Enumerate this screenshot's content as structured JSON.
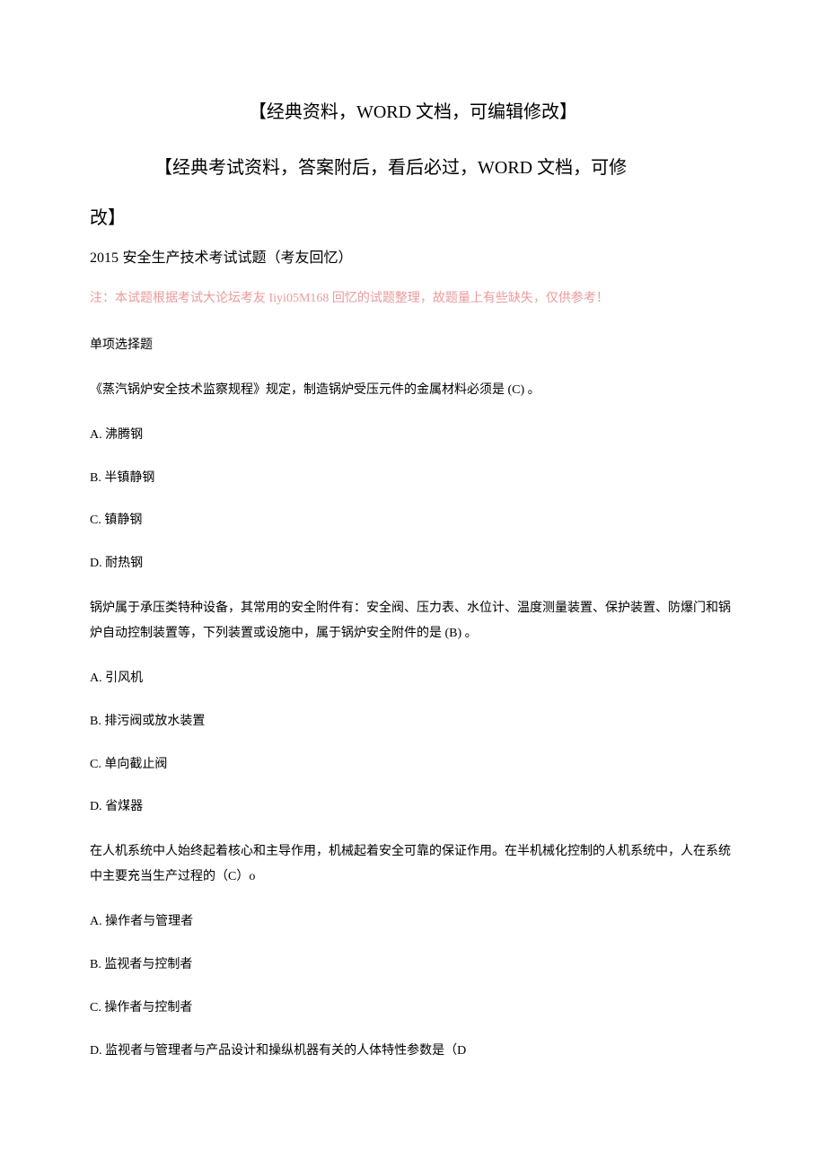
{
  "header": {
    "line1_prefix": "【经典资料，",
    "line1_word": "WORD",
    "line1_suffix": " 文档，可编辑修改】",
    "line2_prefix": "【经典考试资料，答案附后，看后必过，",
    "line2_word": "WORD",
    "line2_suffix": " 文档，可修",
    "line3": "改】"
  },
  "subtitle": {
    "year": "2015",
    "rest": " 安全生产技术考试试题（考友回忆）"
  },
  "note": {
    "prefix": "注：本试题根据考试大论坛考友 ",
    "user": "Iiyi05M168",
    "suffix": " 回忆的试题整理，故题量上有些缺失，仅供参考！"
  },
  "section_title": "单项选择题",
  "q1": {
    "stem": "《蒸汽锅炉安全技术监察规程》规定，制造锅炉受压元件的金属材料必须是 (C) 。",
    "A": "A. 沸腾钢",
    "B": "B. 半镇静钢",
    "C": "C. 镇静钢",
    "D": "D. 耐热钢"
  },
  "q2": {
    "stem": "锅炉属于承压类特种设备，其常用的安全附件有：安全阀、压力表、水位计、温度测量装置、保护装置、防爆门和锅炉自动控制装置等，下列装置或设施中，属于锅炉安全附件的是 (B) 。",
    "A": "A. 引风机",
    "B": "B. 排污阀或放水装置",
    "C": "C. 单向截止阀",
    "D": "D. 省煤器"
  },
  "q3": {
    "stem": "在人机系统中人始终起着核心和主导作用，机械起着安全可靠的保证作用。在半机械化控制的人机系统中，人在系统中主要充当生产过程的（C）o",
    "A": "A. 操作者与管理者",
    "B": "B. 监视者与控制者",
    "C": "C. 操作者与控制者",
    "D": "D. 监视者与管理者与产品设计和操纵机器有关的人体特性参数是（D"
  }
}
